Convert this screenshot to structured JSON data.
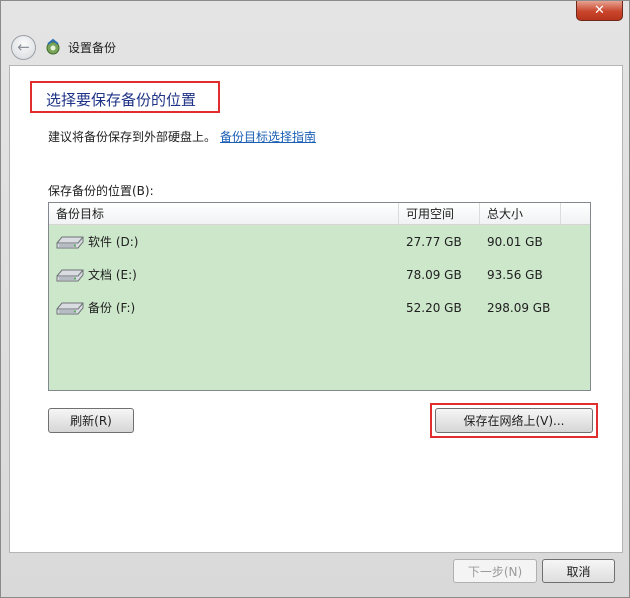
{
  "window": {
    "title": "设置备份",
    "close_glyph": "✕"
  },
  "nav": {
    "back_glyph": "←"
  },
  "main": {
    "heading": "选择要保存备份的位置",
    "advice_text": "建议将备份保存到外部硬盘上。",
    "advice_link": "备份目标选择指南",
    "location_label": "保存备份的位置(B):",
    "columns": [
      "备份目标",
      "可用空间",
      "总大小"
    ],
    "drives": [
      {
        "name": "软件 (D:)",
        "free": "27.77 GB",
        "total": "90.01 GB"
      },
      {
        "name": "文档 (E:)",
        "free": "78.09 GB",
        "total": "93.56 GB"
      },
      {
        "name": "备份 (F:)",
        "free": "52.20 GB",
        "total": "298.09 GB"
      }
    ],
    "list_bg": "#cde7cb"
  },
  "buttons": {
    "refresh": "刷新(R)",
    "save_network": "保存在网络上(V)...",
    "next": "下一步(N)",
    "cancel": "取消"
  },
  "icons": {
    "back": "back-arrow-icon",
    "app": "backup-app-icon",
    "drive": "hard-drive-icon",
    "close": "close-icon"
  }
}
